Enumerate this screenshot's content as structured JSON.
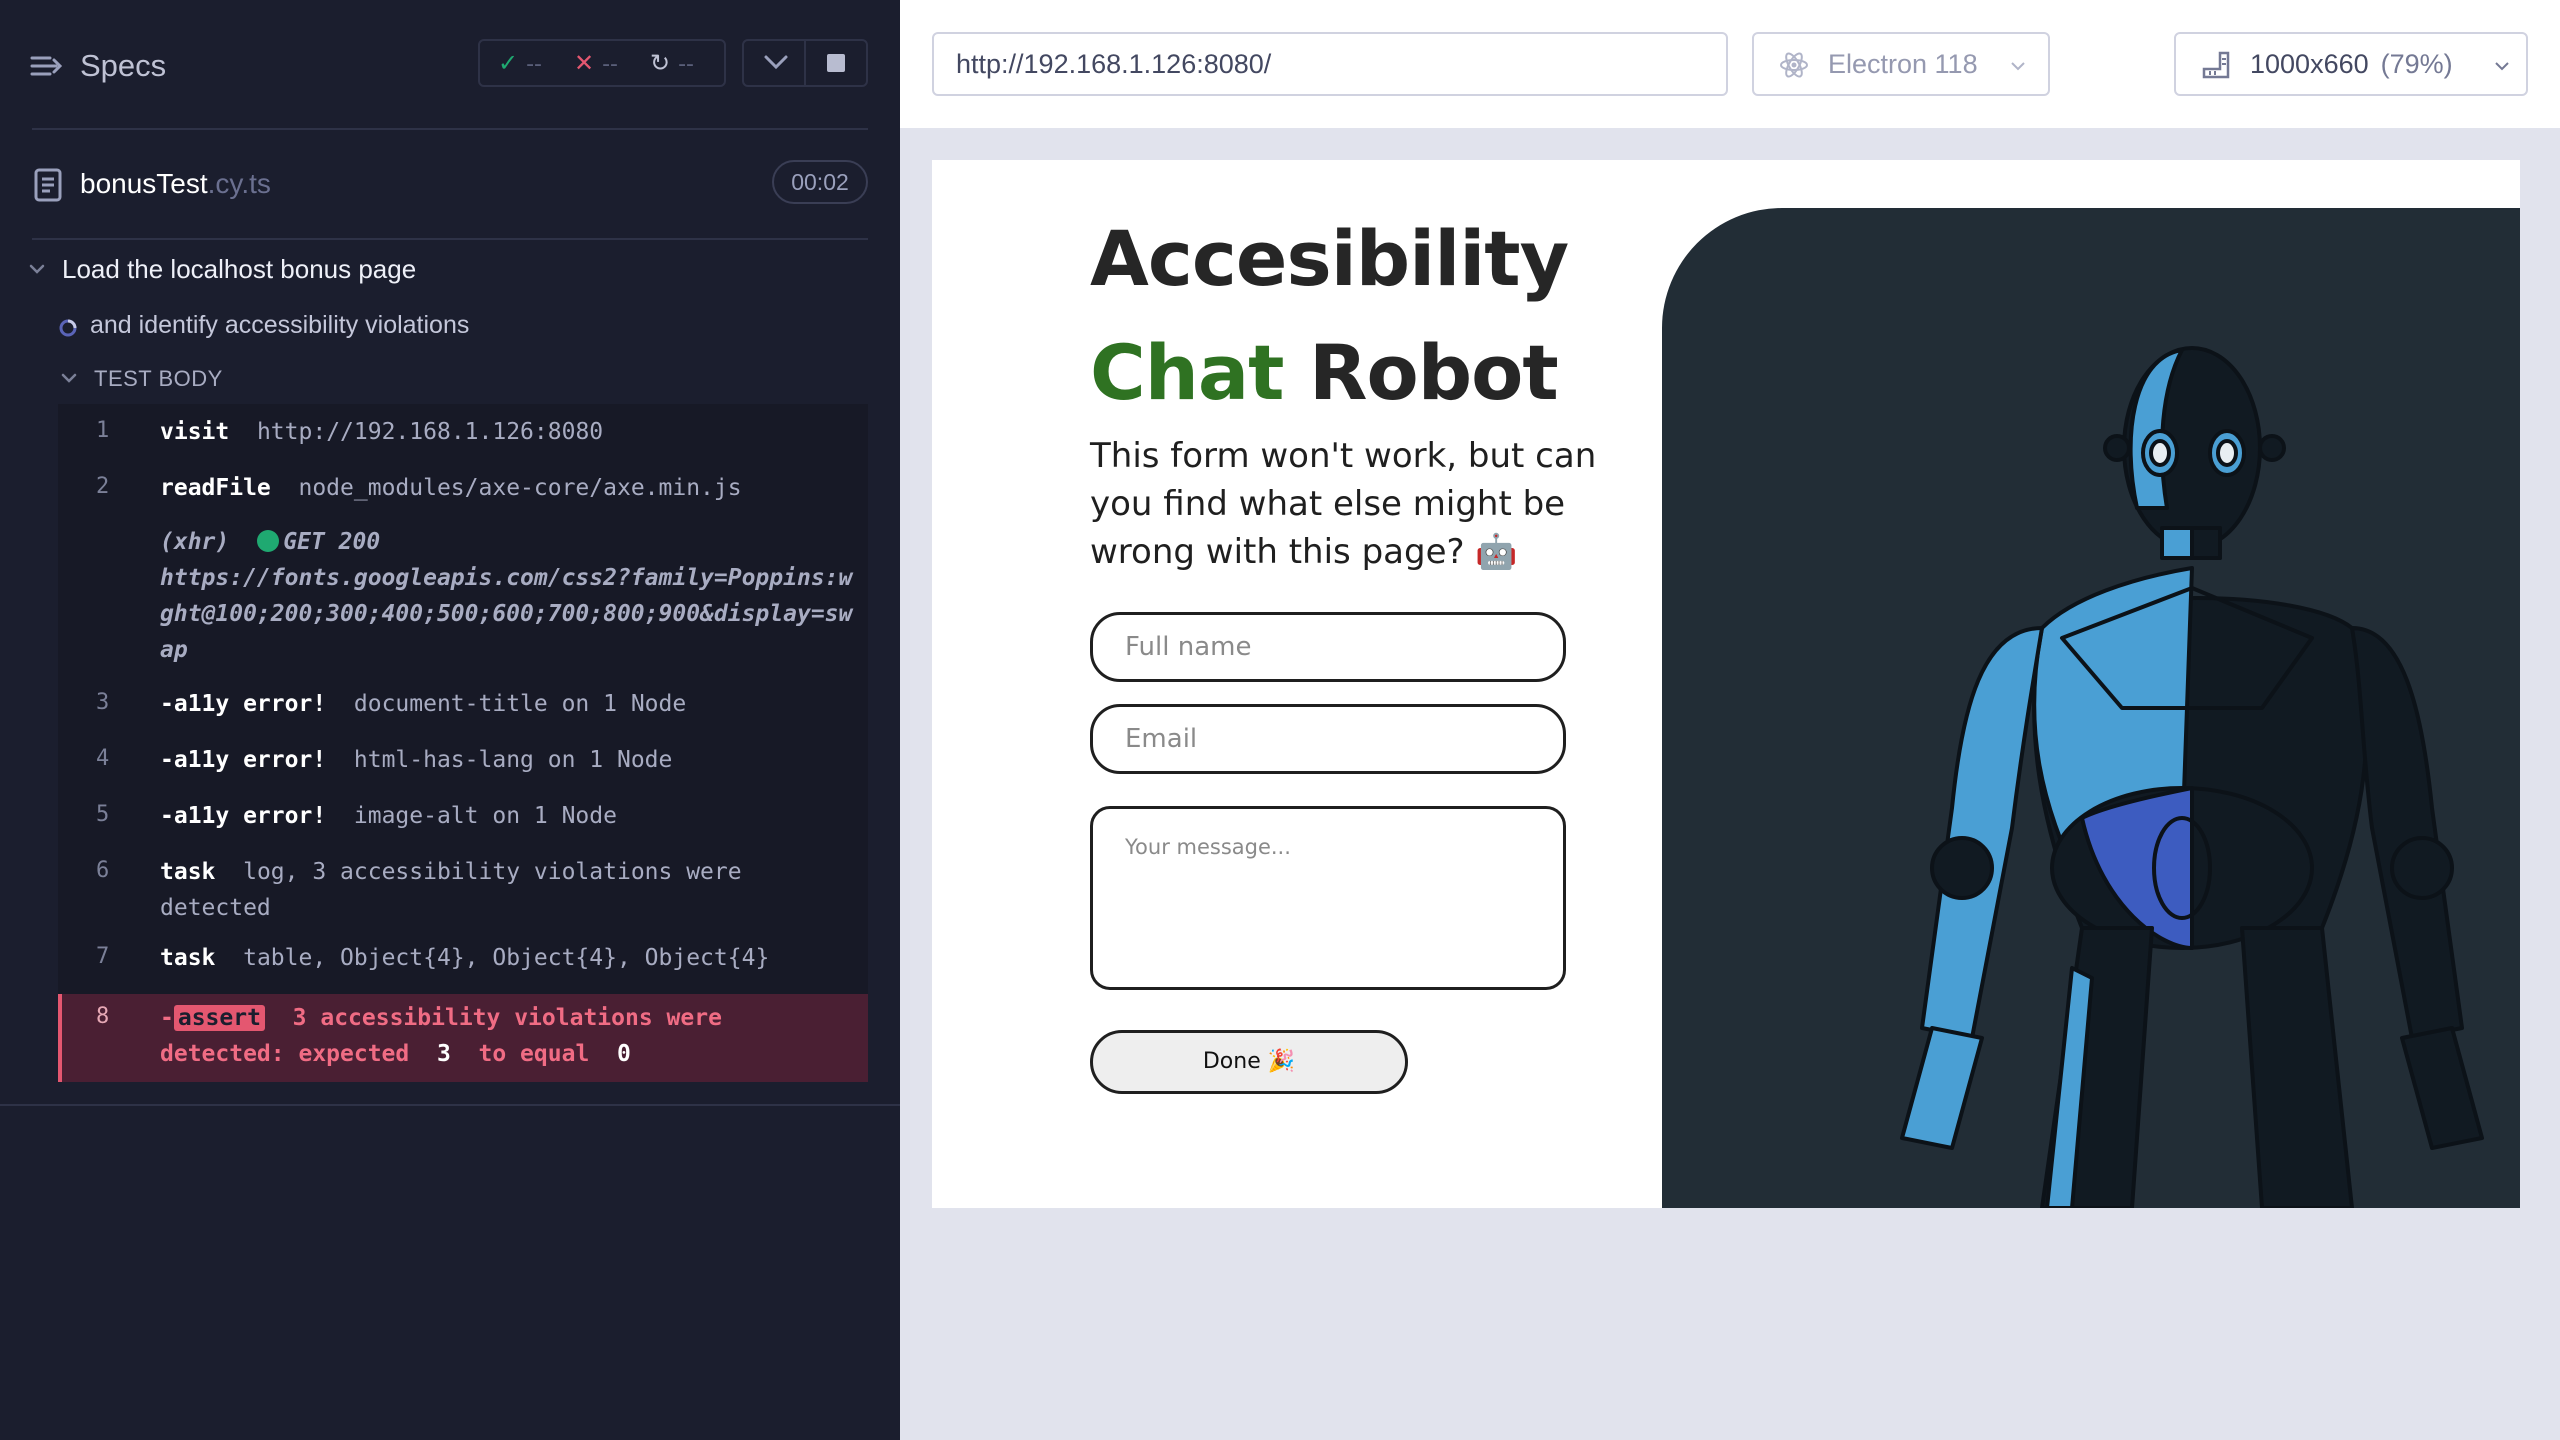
{
  "reporter": {
    "specs_label": "Specs",
    "stats": {
      "passed": "--",
      "failed": "--",
      "pending": "--"
    },
    "spec": {
      "name": "bonusTest",
      "ext": ".cy.ts",
      "duration": "00:02"
    },
    "suite_title": "Load the localhost bonus page",
    "test_title": "and identify accessibility violations",
    "test_body_label": "TEST BODY",
    "commands": [
      {
        "num": "1",
        "name": "visit",
        "message": "http://192.168.1.126:8080"
      },
      {
        "num": "2",
        "name": "readFile",
        "message": "node_modules/axe-core/axe.min.js"
      },
      {
        "xhr_label": "(xhr)",
        "xhr_status": "GET 200",
        "xhr_url": "https://fonts.googleapis.com/css2?family=Poppins:wght@100;200;300;400;500;600;700;800;900&display=swap"
      },
      {
        "num": "3",
        "name": "-a11y error!",
        "message": "document-title on 1 Node"
      },
      {
        "num": "4",
        "name": "-a11y error!",
        "message": "html-has-lang on 1 Node"
      },
      {
        "num": "5",
        "name": "-a11y error!",
        "message": "image-alt on 1 Node"
      },
      {
        "num": "6",
        "name": "task",
        "message": "log, 3 accessibility violations were detected"
      },
      {
        "num": "7",
        "name": "task",
        "message": "table, Object{4}, Object{4}, Object{4}"
      },
      {
        "num": "8",
        "prefix": "-",
        "badge": "assert",
        "message_a": "3 accessibility violations were detected: expected",
        "value_a": "3",
        "message_b": "to equal",
        "value_b": "0"
      }
    ]
  },
  "aut": {
    "url": "http://192.168.1.126:8080/",
    "browser": "Electron 118",
    "viewport": "1000x660",
    "scale": "(79%)"
  },
  "page": {
    "title_line1": "Accesibility",
    "title_green": "Chat",
    "title_rest": "Robot",
    "subtitle": "This form won't work, but can you find what else might be wrong with this page? 🤖",
    "fullname_placeholder": "Full name",
    "email_placeholder": "Email",
    "message_placeholder": "Your message...",
    "done_label": "Done 🎉"
  },
  "colors": {
    "reporter_bg": "#1b1e2e",
    "accent_green": "#2f7222",
    "fail_red": "#e45770",
    "robot_panel": "#222d36",
    "robot_blue": "#4a9fd4"
  }
}
